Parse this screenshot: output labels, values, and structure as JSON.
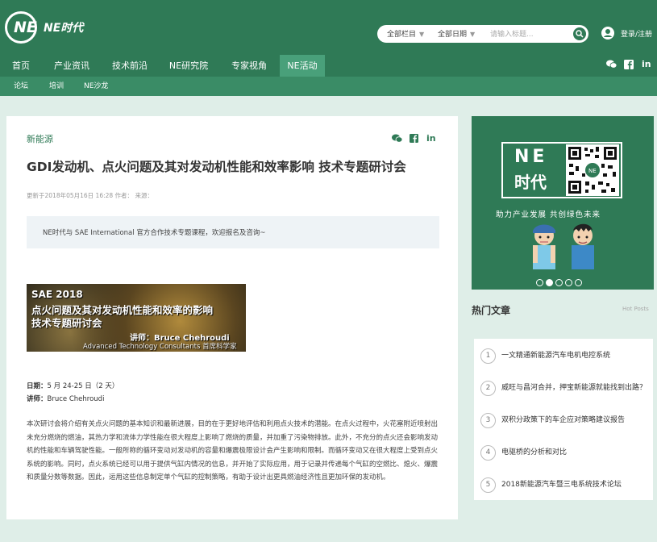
{
  "header": {
    "logo_mark": "NE",
    "logo_text": "NE时代",
    "search": {
      "column_select": "全部栏目",
      "date_select": "全部日期",
      "placeholder": "请输入标题..."
    },
    "login_label": "登录/注册"
  },
  "nav": {
    "items": [
      "首页",
      "产业资讯",
      "技术前沿",
      "NE研究院",
      "专家视角",
      "NE活动"
    ],
    "active_index": 5,
    "social": [
      "wechat-icon",
      "facebook-icon",
      "linkedin-icon"
    ]
  },
  "subnav": {
    "items": [
      "论坛",
      "培训",
      "NE沙龙"
    ]
  },
  "article": {
    "category": "新能源",
    "title": "GDI发动机、点火问题及其对发动机性能和效率影响 技术专题研讨会",
    "meta": "更新于2018年05月16日 16:28   作者：      来源：",
    "notice": "NE时代与 SAE International 官方合作技术专题课程，欢迎报名及咨询~",
    "banner": {
      "line1": "SAE 2018",
      "line2": "点火问题及其对发动机性能和效率的影响",
      "line3": "技术专题研讨会",
      "speaker": "讲师：Bruce Chehroudi",
      "company": "Advanced Technology Consultants 首席科学家"
    },
    "date_label": "日期：",
    "date_value": "5 月 24-25 日（2 天）",
    "lecturer_label": "讲师：",
    "lecturer_value": "Bruce Chehroudi",
    "body": "本次研讨会将介绍有关点火问题的基本知识和最新进展，目的在于更好地评估和利用点火技术的潜能。在点火过程中，火花塞附近喷射出未充分燃烧的燃油，其热力学和流体力学性能在很大程度上影响了燃烧的质量，并加重了污染物排放。此外，不充分的点火还会影响发动机的性能和车辆驾驶性能。一般所称的循环变动对发动机的容量和爆震极限设计会产生影响和限制。而循环变动又在很大程度上受到点火系统的影响。同时，点火系统已经可以用于提供气缸内情况的信息，并开始了实际应用，用于记录并传递每个气缸的空燃比、熄火、爆震和质量分数等数据。因此，运用这些信息制定单个气缸的控制策略，有助于设计出更具燃油经济性且更加环保的发动机。"
  },
  "promo": {
    "brand_line1": "NE",
    "brand_line2": "时代",
    "slogan": "助力产业发展  共创绿色未来",
    "slides": 5,
    "active_slide": 1
  },
  "hot": {
    "title": "热门文章",
    "subtitle": "Hot Posts",
    "items": [
      {
        "num": "1",
        "text": "一文精通新能源汽车电机电控系统"
      },
      {
        "num": "2",
        "text": "威旺与昌河合并，押宝新能源就能找到出路？"
      },
      {
        "num": "3",
        "text": "双积分政策下的车企应对策略建议报告"
      },
      {
        "num": "4",
        "text": "电驱桥的分析和对比"
      },
      {
        "num": "5",
        "text": "2018新能源汽车暨三电系统技术论坛"
      }
    ]
  },
  "colors": {
    "brand_green": "#2f7a56",
    "active_tab": "#49a07a",
    "page_bg": "#dfeee8"
  }
}
